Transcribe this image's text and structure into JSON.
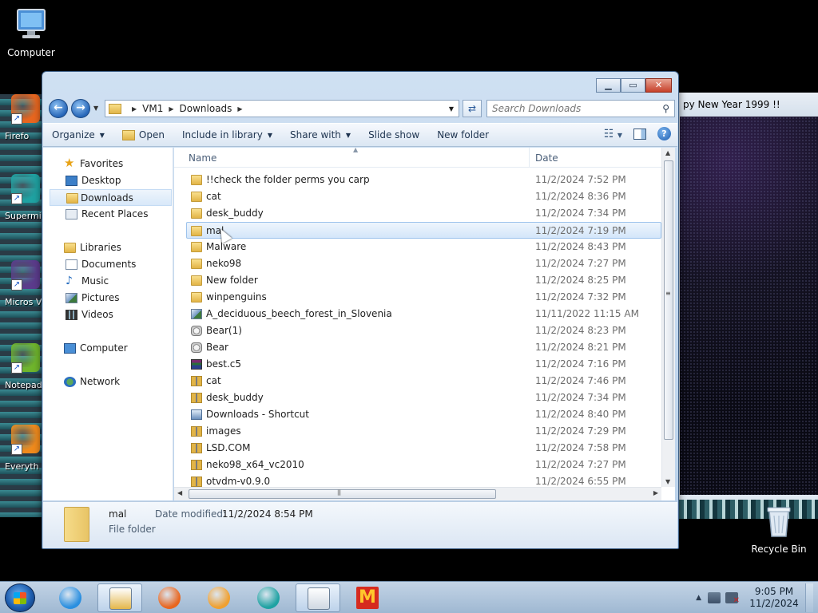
{
  "desktop": {
    "computer_label": "Computer",
    "recycle_label": "Recycle Bin",
    "strip_items": [
      {
        "label": "Firefo",
        "icon": "firefox-icon",
        "color": "#e8661f"
      },
      {
        "label": "Supermi",
        "icon": "supermium-icon",
        "color": "#1fa2a2"
      },
      {
        "label": "Micros Visual St",
        "icon": "visual-studio-icon",
        "color": "#5b3b8c"
      },
      {
        "label": "Notepad",
        "icon": "notepad-icon",
        "color": "#6fb52c"
      },
      {
        "label": "Everyth",
        "icon": "everything-icon",
        "color": "#f08a1c"
      }
    ],
    "bg_window_title": "py New Year 1999 !!"
  },
  "explorer": {
    "address": {
      "crumbs": [
        "VM1",
        "Downloads"
      ]
    },
    "search_placeholder": "Search Downloads",
    "toolbar": {
      "organize": "Organize",
      "open": "Open",
      "include": "Include in library",
      "share": "Share with",
      "slideshow": "Slide show",
      "new_folder": "New folder"
    },
    "nav": {
      "favorites": "Favorites",
      "desktop": "Desktop",
      "downloads": "Downloads",
      "recent": "Recent Places",
      "libraries": "Libraries",
      "documents": "Documents",
      "music": "Music",
      "pictures": "Pictures",
      "videos": "Videos",
      "computer": "Computer",
      "network": "Network"
    },
    "columns": {
      "name": "Name",
      "date": "Date"
    },
    "rows": [
      {
        "name": "!!check the folder perms you carp",
        "date": "11/2/2024 7:52 PM",
        "icon": "folder"
      },
      {
        "name": "cat",
        "date": "11/2/2024 8:36 PM",
        "icon": "folder"
      },
      {
        "name": "desk_buddy",
        "date": "11/2/2024 7:34 PM",
        "icon": "folder"
      },
      {
        "name": "mal",
        "date": "11/2/2024 7:19 PM",
        "icon": "folder"
      },
      {
        "name": "Malware",
        "date": "11/2/2024 8:43 PM",
        "icon": "folder"
      },
      {
        "name": "neko98",
        "date": "11/2/2024 7:27 PM",
        "icon": "folder"
      },
      {
        "name": "New folder",
        "date": "11/2/2024 8:25 PM",
        "icon": "folder"
      },
      {
        "name": "winpenguins",
        "date": "11/2/2024 7:32 PM",
        "icon": "folder"
      },
      {
        "name": "A_deciduous_beech_forest_in_Slovenia",
        "date": "11/11/2022 11:15 AM",
        "icon": "img"
      },
      {
        "name": "Bear(1)",
        "date": "11/2/2024 8:23 PM",
        "icon": "bear"
      },
      {
        "name": "Bear",
        "date": "11/2/2024 8:21 PM",
        "icon": "bear"
      },
      {
        "name": "best.c5",
        "date": "11/2/2024 7:16 PM",
        "icon": "rar"
      },
      {
        "name": "cat",
        "date": "11/2/2024 7:46 PM",
        "icon": "zip"
      },
      {
        "name": "desk_buddy",
        "date": "11/2/2024 7:34 PM",
        "icon": "zip"
      },
      {
        "name": "Downloads - Shortcut",
        "date": "11/2/2024 8:40 PM",
        "icon": "lnk"
      },
      {
        "name": "images",
        "date": "11/2/2024 7:29 PM",
        "icon": "zip"
      },
      {
        "name": "LSD.COM",
        "date": "11/2/2024 7:58 PM",
        "icon": "zip"
      },
      {
        "name": "neko98_x64_vc2010",
        "date": "11/2/2024 7:27 PM",
        "icon": "zip"
      },
      {
        "name": "otvdm-v0.9.0",
        "date": "11/2/2024 6:55 PM",
        "icon": "zip"
      }
    ],
    "selected_row": 3,
    "details": {
      "name": "mal",
      "type": "File folder",
      "modified_label": "Date modified:",
      "modified_value": "11/2/2024 8:54 PM"
    }
  },
  "taskbar": {
    "time": "9:05 PM",
    "date": "11/2/2024",
    "pinned": [
      {
        "name": "internet-explorer-icon",
        "color": "#2a8fe0"
      },
      {
        "name": "file-explorer-icon",
        "color": "#e3b64a"
      },
      {
        "name": "firefox-icon",
        "color": "#e8661f"
      },
      {
        "name": "media-player-icon",
        "color": "#f0a030"
      },
      {
        "name": "supermium-icon",
        "color": "#1fa2a2"
      },
      {
        "name": "screensaver-app-icon",
        "color": "#cfd8e2"
      },
      {
        "name": "mcdonalds-icon",
        "color": "#d62b1e"
      }
    ]
  }
}
